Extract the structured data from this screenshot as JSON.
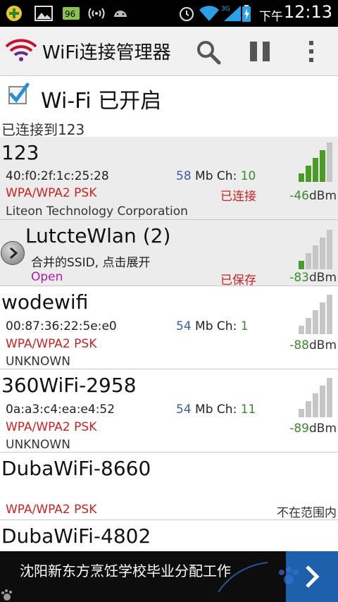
{
  "statusbar": {
    "time": "12:13",
    "ampm": "下午"
  },
  "actionbar": {
    "title": "WiFi连接管理器"
  },
  "toggle": {
    "label": "Wi-Fi 已开启",
    "checked": true
  },
  "section_header": "已连接到123",
  "networks": [
    {
      "ssid": "123",
      "mac": "40:f0:2f:1c:25:28",
      "rate": "58",
      "rate_unit": "Mb",
      "ch_label": "Ch:",
      "channel": "10",
      "security": "WPA/WPA2 PSK",
      "status": "已连接",
      "vendor": "Liteon Technology Corporation",
      "signal": "-46",
      "signal_unit": "dBm",
      "signal_bars": 4
    },
    {
      "ssid": "LutcteWlan (2)",
      "subtitle": "合并的SSID, 点击展开",
      "security": "Open",
      "status": "已保存",
      "signal": "-83",
      "signal_unit": "dBm",
      "signal_bars": 1
    },
    {
      "ssid": "wodewifi",
      "mac": "00:87:36:22:5e:e0",
      "rate": "54",
      "rate_unit": "Mb",
      "ch_label": "Ch:",
      "channel": "1",
      "security": "WPA/WPA2 PSK",
      "vendor": "UNKNOWN",
      "signal": "-88",
      "signal_unit": "dBm",
      "signal_bars": 0
    },
    {
      "ssid": "360WiFi-2958",
      "mac": "0a:a3:c4:ea:e4:52",
      "rate": "54",
      "rate_unit": "Mb",
      "ch_label": "Ch:",
      "channel": "11",
      "security": "WPA/WPA2 PSK",
      "vendor": "UNKNOWN",
      "signal": "-89",
      "signal_unit": "dBm",
      "signal_bars": 0
    },
    {
      "ssid": "DubaWiFi-8660",
      "security": "WPA/WPA2 PSK",
      "status": "不在范围内"
    },
    {
      "ssid": "DubaWiFi-4802"
    }
  ],
  "ad": {
    "text": "沈阳新东方烹饪学校毕业分配工作"
  },
  "colors": {
    "signal_green": "#4c9a2a",
    "signal_gray": "#c6c6c6",
    "security_red": "#cc2222",
    "rate_blue": "#3a5da8",
    "check_blue": "#2a8fd0"
  },
  "icons": {
    "app": "wifi-logo-icon",
    "search": "search-icon",
    "pause": "pause-icon",
    "menu": "overflow-menu-icon",
    "expand": "chevron-right-icon"
  }
}
